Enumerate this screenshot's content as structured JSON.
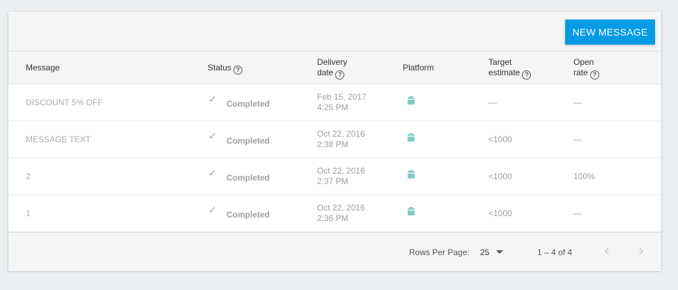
{
  "toolbar": {
    "new_message_label": "NEW MESSAGE"
  },
  "columns": {
    "message": "Message",
    "status": "Status",
    "delivery_line1": "Delivery",
    "delivery_line2": "date",
    "platform": "Platform",
    "target_line1": "Target",
    "target_line2": "estimate",
    "open_line1": "Open",
    "open_line2": "rate"
  },
  "rows": [
    {
      "message": "DISCOUNT 5% OFF",
      "status": "Completed",
      "date": "Feb 15, 2017",
      "time": "4:25 PM",
      "platform_icon": "android-icon",
      "target": "—",
      "open_rate": "—"
    },
    {
      "message": "MESSAGE TEXT",
      "status": "Completed",
      "date": "Oct 22, 2016",
      "time": "2:38 PM",
      "platform_icon": "android-icon",
      "target": "<1000",
      "open_rate": "—"
    },
    {
      "message": "2",
      "status": "Completed",
      "date": "Oct 22, 2016",
      "time": "2:37 PM",
      "platform_icon": "android-icon",
      "target": "<1000",
      "open_rate": "100%"
    },
    {
      "message": "1",
      "status": "Completed",
      "date": "Oct 22, 2016",
      "time": "2:36 PM",
      "platform_icon": "android-icon",
      "target": "<1000",
      "open_rate": "—"
    }
  ],
  "footer": {
    "rows_per_page_label": "Rows Per Page:",
    "rows_per_page_value": "25",
    "range": "1 – 4 of  4"
  },
  "colors": {
    "accent": "#039be5",
    "android": "#80cbc4"
  }
}
